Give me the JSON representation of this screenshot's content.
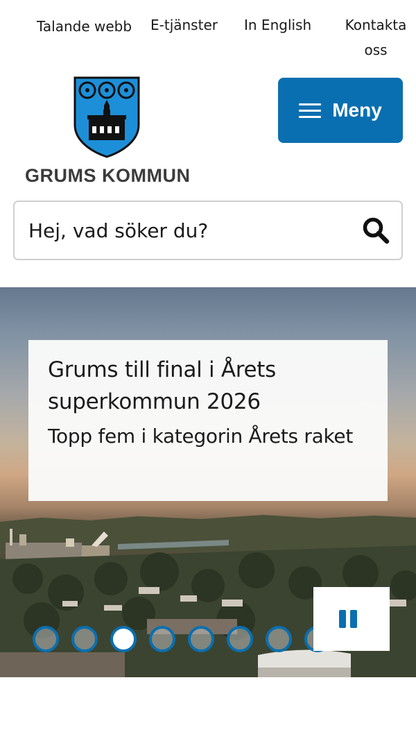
{
  "utility_nav": {
    "links": [
      {
        "label": "Talande webb"
      },
      {
        "label": "E-tjänster"
      },
      {
        "label": "In English"
      },
      {
        "label_line1": "Kontakta",
        "label_line2": "oss"
      }
    ]
  },
  "logo": {
    "text": "GRUMS KOMMUN",
    "icon": "coat-of-arms-icon",
    "colors": {
      "shield": "#1d8fd8",
      "ornament": "#111111"
    }
  },
  "menu_button": {
    "label": "Meny",
    "icon": "hamburger-icon",
    "color": "#0a6fb0"
  },
  "search": {
    "placeholder": "Hej, vad söker du?",
    "icon": "search-icon"
  },
  "hero": {
    "title": "Grums till final i Årets superkommun 2026",
    "subtitle": "Topp fem i kategorin Årets raket",
    "pause_icon": "pause-icon",
    "slides_visible": 8,
    "active_slide": 3,
    "accent": "#0a6fb0"
  }
}
